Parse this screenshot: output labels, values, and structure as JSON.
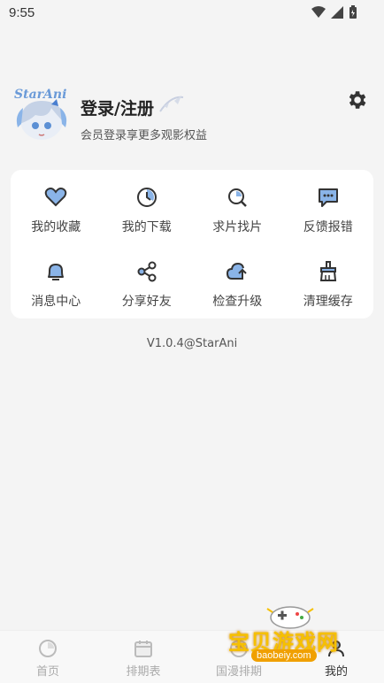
{
  "status": {
    "time": "9:55"
  },
  "profile": {
    "logo_text": "StarAni",
    "login": "登录/注册",
    "subtitle": "会员登录享更多观影权益"
  },
  "menu": [
    {
      "label": "我的收藏",
      "icon": "heart-icon"
    },
    {
      "label": "我的下载",
      "icon": "download-clock-icon"
    },
    {
      "label": "求片找片",
      "icon": "search-icon"
    },
    {
      "label": "反馈报错",
      "icon": "feedback-icon"
    },
    {
      "label": "消息中心",
      "icon": "bell-icon"
    },
    {
      "label": "分享好友",
      "icon": "share-icon"
    },
    {
      "label": "检查升级",
      "icon": "upgrade-icon"
    },
    {
      "label": "清理缓存",
      "icon": "clean-icon"
    }
  ],
  "version": "V1.0.4@StarAni",
  "tabs": [
    {
      "label": "首页",
      "icon": "home-icon"
    },
    {
      "label": "排期表",
      "icon": "calendar-icon"
    },
    {
      "label": "国漫排期",
      "icon": "list-icon"
    },
    {
      "label": "我的",
      "icon": "user-icon"
    }
  ],
  "watermark": {
    "text": "宝贝游戏网",
    "url": "baobeiy.com"
  },
  "colors": {
    "accent": "#8ab4e8",
    "icon_dark": "#333333",
    "background": "#f4f4f4"
  }
}
